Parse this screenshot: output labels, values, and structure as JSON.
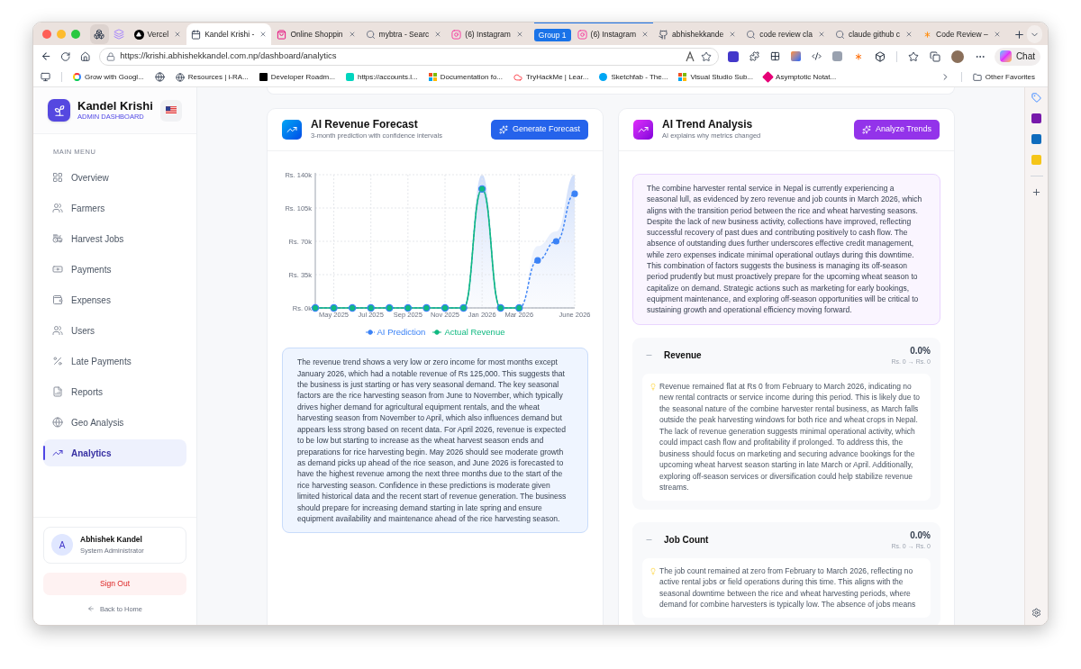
{
  "browser": {
    "pinned_tabs": [
      {
        "selected": false
      },
      {
        "selected": false
      }
    ],
    "tabs": [
      {
        "title": "Vercel",
        "selected": false
      },
      {
        "title": "Kandel Krishi -",
        "selected": true
      },
      {
        "title": "Online Shoppin",
        "selected": false
      },
      {
        "title": "mybtra - Searc",
        "selected": false
      },
      {
        "title": "(6) Instagram",
        "selected": false
      }
    ],
    "tab_group": {
      "label": "Group 1",
      "tabs": [
        {
          "title": "(6) Instagram",
          "selected": false
        }
      ]
    },
    "tabs_after": [
      {
        "title": "abhishekkande",
        "selected": false
      },
      {
        "title": "code review cla",
        "selected": false
      },
      {
        "title": "claude github c",
        "selected": false
      },
      {
        "title": "Code Review –",
        "selected": false
      }
    ],
    "url": "https://krishi.abhishekkandel.com.np/dashboard/analytics",
    "chat_label": "Chat",
    "bookmarks": [
      {
        "label": "Grow with Googl..."
      },
      {
        "label": "Resources | i-RA..."
      },
      {
        "label": "Developer Roadm..."
      },
      {
        "label": "https://accounts.l..."
      },
      {
        "label": "Documentation fo..."
      },
      {
        "label": "TryHackMe | Lear..."
      },
      {
        "label": "Sketchfab - The..."
      },
      {
        "label": "Visual Studio Sub..."
      },
      {
        "label": "Asymptotic Notat..."
      }
    ],
    "other_favorites": "Other Favorites"
  },
  "sidebar": {
    "title": "Kandel Krishi",
    "subtitle": "ADMIN DASHBOARD",
    "menu_heading": "MAIN MENU",
    "items": [
      {
        "label": "Overview",
        "selected": false
      },
      {
        "label": "Farmers",
        "selected": false
      },
      {
        "label": "Harvest Jobs",
        "selected": false
      },
      {
        "label": "Payments",
        "selected": false
      },
      {
        "label": "Expenses",
        "selected": false
      },
      {
        "label": "Users",
        "selected": false
      },
      {
        "label": "Late Payments",
        "selected": false
      },
      {
        "label": "Reports",
        "selected": false
      },
      {
        "label": "Geo Analysis",
        "selected": false
      },
      {
        "label": "Analytics",
        "selected": true
      }
    ],
    "user": {
      "initial": "A",
      "name": "Abhishek Kandel",
      "role": "System Administrator"
    },
    "sign_out": "Sign Out",
    "back_home": "Back to Home"
  },
  "forecast": {
    "title": "AI Revenue Forecast",
    "subtitle": "3-month prediction with confidence intervals",
    "button": "Generate Forecast",
    "chart_data": {
      "type": "line",
      "grid": true,
      "legend": true,
      "categories": [
        null,
        "May 2025",
        null,
        "Jul 2025",
        null,
        "Sep 2025",
        null,
        "Nov 2025",
        null,
        "Jan 2026",
        null,
        "Mar 2026",
        null,
        null,
        "June 2026"
      ],
      "ylim": [
        0,
        140000
      ],
      "yticks": [
        {
          "value": 0,
          "label": "Rs. 0k"
        },
        {
          "value": 35000,
          "label": "Rs. 35k"
        },
        {
          "value": 70000,
          "label": "Rs. 70k"
        },
        {
          "value": 105000,
          "label": "Rs. 105k"
        },
        {
          "value": 140000,
          "label": "Rs. 140k"
        }
      ],
      "series": [
        {
          "name": "AI Prediction",
          "color": "#3b82f6",
          "line_style": "dashed",
          "values": [
            0,
            0,
            0,
            0,
            0,
            0,
            0,
            0,
            0,
            125000,
            0,
            0,
            50000,
            70000,
            120000
          ]
        },
        {
          "name": "Actual Revenue",
          "color": "#10b981",
          "line_style": "solid",
          "values": [
            0,
            0,
            0,
            0,
            0,
            0,
            0,
            0,
            0,
            125000,
            0,
            0,
            null,
            null,
            null
          ]
        }
      ]
    },
    "summary": "The revenue trend shows a very low or zero income for most months except January 2026, which had a notable revenue of Rs 125,000. This suggests that the business is just starting or has very seasonal demand. The key seasonal factors are the rice harvesting season from June to November, which typically drives higher demand for agricultural equipment rentals, and the wheat harvesting season from November to April, which also influences demand but appears less strong based on recent data. For April 2026, revenue is expected to be low but starting to increase as the wheat harvest season ends and preparations for rice harvesting begin. May 2026 should see moderate growth as demand picks up ahead of the rice season, and June 2026 is forecasted to have the highest revenue among the next three months due to the start of the rice harvesting season. Confidence in these predictions is moderate given limited historical data and the recent start of revenue generation. The business should prepare for increasing demand starting in late spring and ensure equipment availability and maintenance ahead of the rice harvesting season."
  },
  "trends": {
    "title": "AI Trend Analysis",
    "subtitle": "AI explains why metrics changed",
    "button": "Analyze Trends",
    "summary": "The combine harvester rental service in Nepal is currently experiencing a seasonal lull, as evidenced by zero revenue and job counts in March 2026, which aligns with the transition period between the rice and wheat harvesting seasons. Despite the lack of new business activity, collections have improved, reflecting successful recovery of past dues and contributing positively to cash flow. The absence of outstanding dues further underscores effective credit management, while zero expenses indicate minimal operational outlays during this downtime. This combination of factors suggests the business is managing its off-season period prudently but must proactively prepare for the upcoming wheat season to capitalize on demand. Strategic actions such as marketing for early bookings, equipment maintenance, and exploring off-season opportunities will be critical to sustaining growth and operational efficiency moving forward.",
    "metrics": [
      {
        "name": "Revenue",
        "change": "0.0%",
        "range": "Rs. 0 → Rs. 0",
        "explanation": "Revenue remained flat at Rs 0 from February to March 2026, indicating no new rental contracts or service income during this period. This is likely due to the seasonal nature of the combine harvester rental business, as March falls outside the peak harvesting windows for both rice and wheat crops in Nepal. The lack of revenue generation suggests minimal operational activity, which could impact cash flow and profitability if prolonged. To address this, the business should focus on marketing and securing advance bookings for the upcoming wheat harvest season starting in late March or April. Additionally, exploring off-season services or diversification could help stabilize revenue streams."
      },
      {
        "name": "Job Count",
        "change": "0.0%",
        "range": "Rs. 0 → Rs. 0",
        "explanation": "The job count remained at zero from February to March 2026, reflecting no active rental jobs or field operations during this time. This aligns with the seasonal downtime between the rice and wheat harvesting periods, where demand for combine harvesters is typically low. The absence of jobs means"
      }
    ]
  }
}
